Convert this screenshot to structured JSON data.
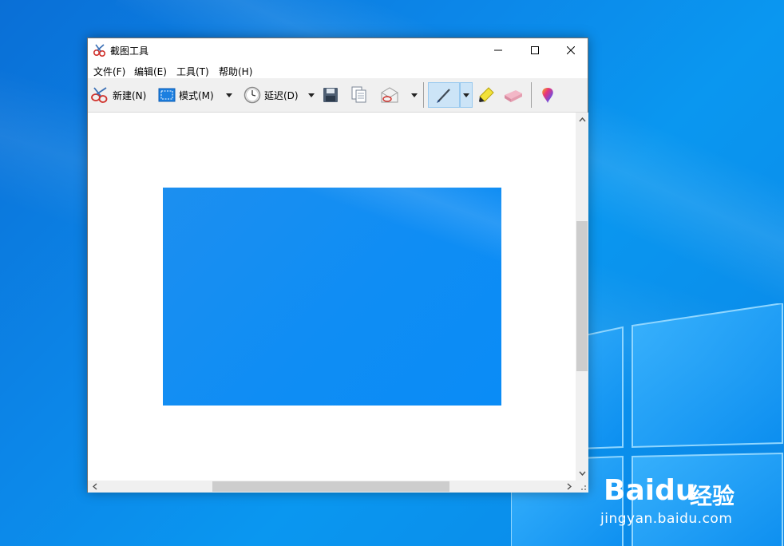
{
  "window": {
    "title": "截图工具",
    "controls": [
      "minimize",
      "maximize",
      "close"
    ]
  },
  "menu": {
    "items": [
      {
        "label": "文件(F)"
      },
      {
        "label": "编辑(E)"
      },
      {
        "label": "工具(T)"
      },
      {
        "label": "帮助(H)"
      }
    ]
  },
  "toolbar": {
    "new_label": "新建(N)",
    "mode_label": "模式(M)",
    "delay_label": "延迟(D)",
    "icons": [
      "scissors-icon",
      "rect-snip-icon",
      "clock-icon",
      "save-icon",
      "copy-icon",
      "send-mail-icon",
      "pen-icon",
      "highlighter-icon",
      "eraser-icon",
      "paint3d-icon"
    ]
  },
  "colors": {
    "desktop": "#0a86e8",
    "snip": "#0f8df4",
    "toolbar_bg": "#f0f0f0",
    "pen_active": "#cce4f7"
  },
  "watermark": {
    "brand": "Baidu",
    "brand_cn": "经验",
    "url": "jingyan.baidu.com"
  }
}
